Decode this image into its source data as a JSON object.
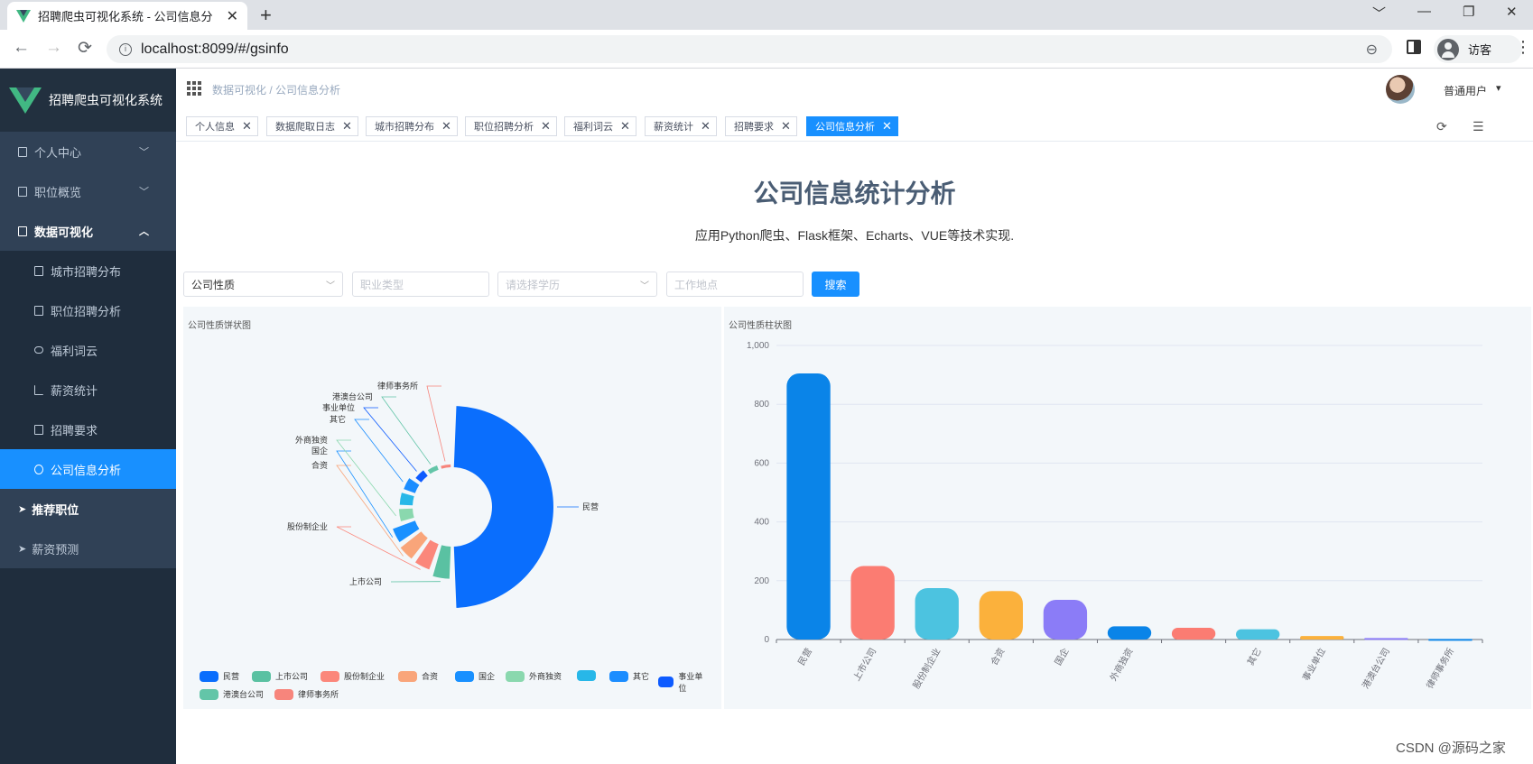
{
  "browser": {
    "tab_title": "招聘爬虫可视化系统 - 公司信息分",
    "tab_close": "✕",
    "new_tab": "+",
    "url": "localhost:8099/#/gsinfo",
    "profile_label": "访客",
    "controls": {
      "minimize": "—",
      "restore": "❐",
      "close": "✕",
      "collapse": "﹀"
    }
  },
  "sidebar": {
    "app_name": "招聘爬虫可视化系统",
    "items": [
      {
        "label": "个人中心",
        "chevron": "﹀"
      },
      {
        "label": "职位概览",
        "chevron": "﹀"
      },
      {
        "label": "数据可视化",
        "chevron": "︿"
      }
    ],
    "sub_items": [
      {
        "label": "城市招聘分布"
      },
      {
        "label": "职位招聘分析"
      },
      {
        "label": "福利词云"
      },
      {
        "label": "薪资统计"
      },
      {
        "label": "招聘要求"
      },
      {
        "label": "公司信息分析"
      }
    ],
    "bottom_items": [
      {
        "label": "推荐职位"
      },
      {
        "label": "薪资预测"
      }
    ]
  },
  "navbar": {
    "breadcrumb": "数据可视化 / 公司信息分析",
    "username": "普通用户",
    "caret": "▾"
  },
  "tags": [
    {
      "label": "个人信息"
    },
    {
      "label": "数据爬取日志"
    },
    {
      "label": "城市招聘分布"
    },
    {
      "label": "职位招聘分析"
    },
    {
      "label": "福利词云"
    },
    {
      "label": "薪资统计"
    },
    {
      "label": "招聘要求"
    },
    {
      "label": "公司信息分析"
    }
  ],
  "tag_close": "✕",
  "main": {
    "title": "公司信息统计分析",
    "subtitle": "应用Python爬虫、Flask框架、Echarts、VUE等技术实现.",
    "filters": {
      "company_type": "公司性质",
      "job_type_placeholder": "职业类型",
      "education_placeholder": "请选择学历",
      "location_placeholder": "工作地点",
      "search_label": "搜索"
    },
    "pie_title": "公司性质饼状图",
    "bar_title": "公司性质柱状图"
  },
  "colors": {
    "accent": "#1890ff",
    "sidebar_bg": "#304156",
    "sidebar_dark": "#1f2d3d",
    "palette": [
      "#0a6efd",
      "#5ac1a2",
      "#fb877b",
      "#f9a57a",
      "#1890ff",
      "#8ad8ae",
      "#27b7e8",
      "#1b8dff",
      "#0d5bff",
      "#63c5a8",
      "#f7857c"
    ]
  },
  "chart_data": [
    {
      "type": "pie",
      "title": "公司性质饼状图",
      "rose": true,
      "labels": [
        "民营",
        "上市公司",
        "股份制企业",
        "合资",
        "国企",
        "外商独资",
        "",
        "其它",
        "事业单位",
        "港澳台公司",
        "律师事务所"
      ],
      "values": [
        905,
        250,
        175,
        165,
        135,
        45,
        40,
        35,
        12,
        5,
        2
      ],
      "colors": [
        "#0a6efd",
        "#5ac1a2",
        "#fb877b",
        "#f9a57a",
        "#1890ff",
        "#8ad8ae",
        "#27b7e8",
        "#1b8dff",
        "#0d5bff",
        "#63c5a8",
        "#f7857c"
      ],
      "legend": [
        "民营",
        "上市公司",
        "股份制企业",
        "合资",
        "国企",
        "外商独资",
        "",
        "其它",
        "事业单位",
        "港澳台公司",
        "律师事务所"
      ],
      "legend_position": "bottom-left"
    },
    {
      "type": "bar",
      "title": "公司性质柱状图",
      "categories": [
        "民营",
        "上市公司",
        "股份制企业",
        "合资",
        "国企",
        "外商独资",
        "",
        "其它",
        "事业单位",
        "港澳台公司",
        "律师事务所"
      ],
      "values": [
        905,
        250,
        175,
        165,
        135,
        45,
        40,
        35,
        12,
        5,
        2
      ],
      "colors": [
        "#0a84e8",
        "#fb7c72",
        "#4cc3e0",
        "#fbb13c",
        "#8b7cf7",
        "#0a84e8",
        "#fb7c72",
        "#4cc3e0",
        "#fbb13c",
        "#8b7cf7",
        "#0a84e8"
      ],
      "ylim": [
        0,
        1000
      ],
      "yticks": [
        "0",
        "200",
        "400",
        "600",
        "800",
        "1,000"
      ],
      "grid": true
    }
  ],
  "watermark": "CSDN @源码之家"
}
